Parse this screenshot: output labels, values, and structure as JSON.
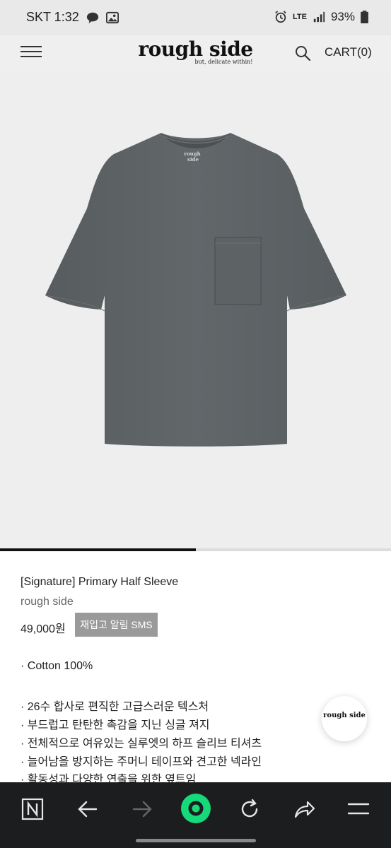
{
  "status_bar": {
    "carrier_time": "SKT 1:32",
    "network": "LTE",
    "battery": "93%"
  },
  "header": {
    "logo_main": "rough side",
    "logo_tagline": "but, delicate within!",
    "cart_label": "CART(0)"
  },
  "gallery": {
    "image_label": "rough side",
    "progress_fraction": 0.5
  },
  "product": {
    "name": "[Signature] Primary Half Sleeve",
    "brand": "rough side",
    "price": "49,000원",
    "restock_label": "재입고 알림 SMS",
    "description": [
      "· Cotton 100%",
      "· 26수 합사로 편직한 고급스러운 텍스처",
      "· 부드럽고 탄탄한 촉감을 지닌 싱글 져지",
      "· 전체적으로 여유있는 실루엣의 하프 슬리브 티셔츠",
      "· 늘어남을 방지하는 주머니 테이프와 견고한 넥라인",
      "· 활동성과 다양한 연출을 위한 옆트임"
    ]
  },
  "floating_badge": {
    "logo_main": "rough side"
  },
  "colors": {
    "shirt": "#5f6466",
    "accent_green": "#16d97a",
    "bottom_bar": "#1c1d1f"
  },
  "icons": [
    "talk-icon",
    "gallery-icon",
    "alarm-icon",
    "signal-icon",
    "battery-icon",
    "menu-icon",
    "search-icon",
    "n-icon",
    "back-icon",
    "forward-icon",
    "home-circle-icon",
    "refresh-icon",
    "share-icon",
    "menu-icon"
  ]
}
